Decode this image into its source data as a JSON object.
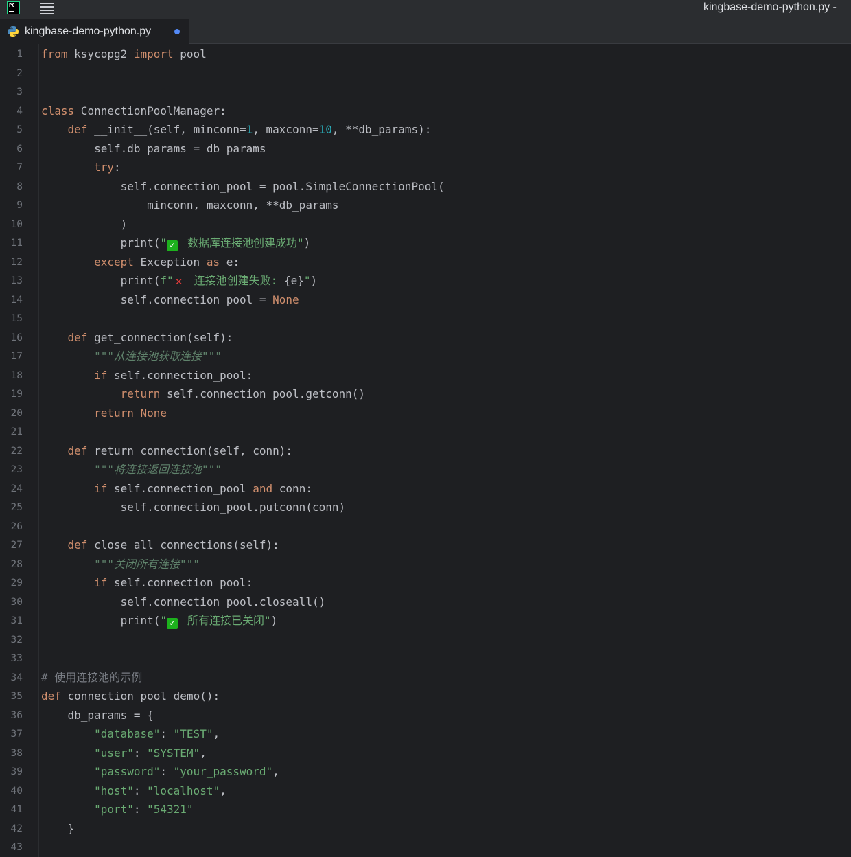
{
  "window": {
    "title": "kingbase-demo-python.py -"
  },
  "tabs": [
    {
      "label": "kingbase-demo-python.py",
      "modified": true
    }
  ],
  "icons": {
    "app": "pycharm-logo-icon",
    "menu": "hamburger-menu-icon",
    "file": "python-file-icon",
    "check": "white-check-mark-emoji",
    "cross": "cross-mark-emoji"
  },
  "colors": {
    "background": "#1e1f22",
    "keyword": "#cf8e6d",
    "number": "#2aacb8",
    "string": "#6aab73",
    "docstring": "#5f826b",
    "comment": "#7a7e85",
    "text": "#bcbec4"
  },
  "editor": {
    "lines": [
      [
        [
          "kw",
          "from"
        ],
        [
          "t",
          " ksycopg2 "
        ],
        [
          "kw",
          "import"
        ],
        [
          "t",
          " pool"
        ]
      ],
      [],
      [],
      [
        [
          "kw",
          "class"
        ],
        [
          "t",
          " ConnectionPoolManager:"
        ]
      ],
      [
        [
          "t",
          "    "
        ],
        [
          "kw",
          "def"
        ],
        [
          "t",
          " __init__(self, minconn="
        ],
        [
          "num",
          "1"
        ],
        [
          "t",
          ", maxconn="
        ],
        [
          "num",
          "10"
        ],
        [
          "t",
          ", **db_params):"
        ]
      ],
      [
        [
          "t",
          "        self.db_params = db_params"
        ]
      ],
      [
        [
          "t",
          "        "
        ],
        [
          "kw",
          "try"
        ],
        [
          "t",
          ":"
        ]
      ],
      [
        [
          "t",
          "            self.connection_pool = pool.SimpleConnectionPool("
        ]
      ],
      [
        [
          "t",
          "                minconn, maxconn, **db_params"
        ]
      ],
      [
        [
          "t",
          "            )"
        ]
      ],
      [
        [
          "t",
          "            print("
        ],
        [
          "str",
          "\""
        ],
        [
          "ok",
          "✓"
        ],
        [
          "str",
          "数据库连接池创建成功\""
        ],
        [
          "t",
          ")"
        ]
      ],
      [
        [
          "t",
          "        "
        ],
        [
          "kw",
          "except"
        ],
        [
          "t",
          " Exception "
        ],
        [
          "kw",
          "as"
        ],
        [
          "t",
          " e:"
        ]
      ],
      [
        [
          "t",
          "            print("
        ],
        [
          "str",
          "f\""
        ],
        [
          "x",
          "✕"
        ],
        [
          "str",
          "连接池创建失败: "
        ],
        [
          "t",
          "{e}"
        ],
        [
          "str",
          "\""
        ],
        [
          "t",
          ")"
        ]
      ],
      [
        [
          "t",
          "            self.connection_pool = "
        ],
        [
          "kw",
          "None"
        ]
      ],
      [],
      [
        [
          "t",
          "    "
        ],
        [
          "kw",
          "def"
        ],
        [
          "t",
          " get_connection(self):"
        ]
      ],
      [
        [
          "t",
          "        "
        ],
        [
          "doc",
          "\"\"\"从连接池获取连接\"\"\""
        ]
      ],
      [
        [
          "t",
          "        "
        ],
        [
          "kw",
          "if"
        ],
        [
          "t",
          " self.connection_pool:"
        ]
      ],
      [
        [
          "t",
          "            "
        ],
        [
          "kw",
          "return"
        ],
        [
          "t",
          " self.connection_pool.getconn()"
        ]
      ],
      [
        [
          "t",
          "        "
        ],
        [
          "kw",
          "return"
        ],
        [
          "t",
          " "
        ],
        [
          "kw",
          "None"
        ]
      ],
      [],
      [
        [
          "t",
          "    "
        ],
        [
          "kw",
          "def"
        ],
        [
          "t",
          " return_connection(self, conn):"
        ]
      ],
      [
        [
          "t",
          "        "
        ],
        [
          "doc",
          "\"\"\"将连接返回连接池\"\"\""
        ]
      ],
      [
        [
          "t",
          "        "
        ],
        [
          "kw",
          "if"
        ],
        [
          "t",
          " self.connection_pool "
        ],
        [
          "kw",
          "and"
        ],
        [
          "t",
          " conn:"
        ]
      ],
      [
        [
          "t",
          "            self.connection_pool.putconn(conn)"
        ]
      ],
      [],
      [
        [
          "t",
          "    "
        ],
        [
          "kw",
          "def"
        ],
        [
          "t",
          " close_all_connections(self):"
        ]
      ],
      [
        [
          "t",
          "        "
        ],
        [
          "doc",
          "\"\"\"关闭所有连接\"\"\""
        ]
      ],
      [
        [
          "t",
          "        "
        ],
        [
          "kw",
          "if"
        ],
        [
          "t",
          " self.connection_pool:"
        ]
      ],
      [
        [
          "t",
          "            self.connection_pool.closeall()"
        ]
      ],
      [
        [
          "t",
          "            print("
        ],
        [
          "str",
          "\""
        ],
        [
          "ok",
          "✓"
        ],
        [
          "str",
          "所有连接已关闭\""
        ],
        [
          "t",
          ")"
        ]
      ],
      [],
      [],
      [
        [
          "cmt",
          "# 使用连接池的示例"
        ]
      ],
      [
        [
          "kw",
          "def"
        ],
        [
          "t",
          " connection_pool_demo():"
        ]
      ],
      [
        [
          "t",
          "    db_params = {"
        ]
      ],
      [
        [
          "t",
          "        "
        ],
        [
          "str",
          "\"database\""
        ],
        [
          "t",
          ": "
        ],
        [
          "str",
          "\"TEST\""
        ],
        [
          "t",
          ","
        ]
      ],
      [
        [
          "t",
          "        "
        ],
        [
          "str",
          "\"user\""
        ],
        [
          "t",
          ": "
        ],
        [
          "str",
          "\"SYSTEM\""
        ],
        [
          "t",
          ","
        ]
      ],
      [
        [
          "t",
          "        "
        ],
        [
          "str",
          "\"password\""
        ],
        [
          "t",
          ": "
        ],
        [
          "str",
          "\"your_password\""
        ],
        [
          "t",
          ","
        ]
      ],
      [
        [
          "t",
          "        "
        ],
        [
          "str",
          "\"host\""
        ],
        [
          "t",
          ": "
        ],
        [
          "str",
          "\"localhost\""
        ],
        [
          "t",
          ","
        ]
      ],
      [
        [
          "t",
          "        "
        ],
        [
          "str",
          "\"port\""
        ],
        [
          "t",
          ": "
        ],
        [
          "str",
          "\"54321\""
        ]
      ],
      [
        [
          "t",
          "    }"
        ]
      ],
      []
    ]
  }
}
